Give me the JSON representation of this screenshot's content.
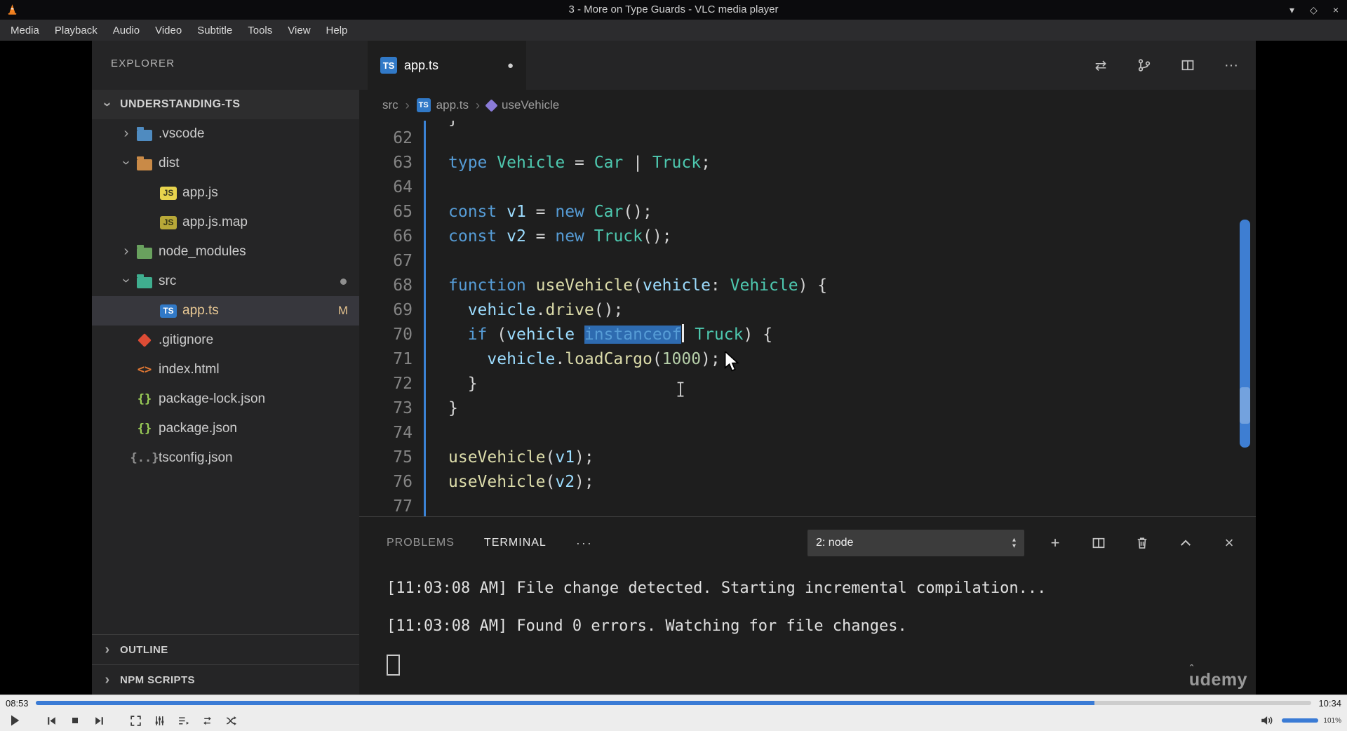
{
  "icons": {
    "chevron": "›",
    "window_min": "▾",
    "window_max": "◇",
    "window_close": "×",
    "tab_dirty_dot": "●",
    "overflow": "···",
    "plus": "+",
    "close": "×",
    "open_changes": "⇄",
    "breadcrumb_sep": "›",
    "dropdown_up": "▴",
    "dropdown_down": "▾"
  },
  "vlc": {
    "titlebar": {
      "title": "3 - More on Type Guards - VLC media player"
    },
    "menu_items": [
      "Media",
      "Playback",
      "Audio",
      "Video",
      "Subtitle",
      "Tools",
      "View",
      "Help"
    ],
    "seek": {
      "elapsed": "08:53",
      "total": "10:34",
      "progress_pct": 83
    },
    "volume": {
      "label": "101%",
      "fill_pct": 100
    }
  },
  "vscode": {
    "explorer": {
      "header": "EXPLORER",
      "project_label": "UNDERSTANDING-TS",
      "tree": [
        {
          "label": ".vscode",
          "depth": 1,
          "chevron": "collapsed",
          "icon": {
            "kind": "folder",
            "color": "#4f8bc0"
          }
        },
        {
          "label": "dist",
          "depth": 1,
          "chevron": "expanded",
          "icon": {
            "kind": "folder",
            "color": "#c98a47"
          }
        },
        {
          "label": "app.js",
          "depth": 2,
          "icon": {
            "kind": "badge",
            "text": "JS",
            "bg": "#e8d44d",
            "fg": "#3a3a20"
          }
        },
        {
          "label": "app.js.map",
          "depth": 2,
          "icon": {
            "kind": "badge",
            "text": "JS",
            "bg": "#b8a838",
            "fg": "#343414"
          }
        },
        {
          "label": "node_modules",
          "depth": 1,
          "chevron": "collapsed",
          "icon": {
            "kind": "folder",
            "color": "#69a15e"
          }
        },
        {
          "label": "src",
          "depth": 1,
          "chevron": "expanded",
          "icon": {
            "kind": "folder",
            "color": "#3fae8f"
          },
          "dot": true
        },
        {
          "label": "app.ts",
          "depth": 2,
          "icon": {
            "kind": "badge",
            "text": "TS",
            "bg": "#3179c7",
            "fg": "#ffffff"
          },
          "selected": true,
          "badge": "M"
        },
        {
          "label": ".gitignore",
          "depth": 1,
          "icon": {
            "kind": "diamond",
            "color": "#dd4c35"
          }
        },
        {
          "label": "index.html",
          "depth": 1,
          "icon": {
            "kind": "glyph",
            "text": "<>",
            "color": "#e37933"
          }
        },
        {
          "label": "package-lock.json",
          "depth": 1,
          "icon": {
            "kind": "glyph",
            "text": "{}",
            "color": "#9acd57"
          }
        },
        {
          "label": "package.json",
          "depth": 1,
          "icon": {
            "kind": "glyph",
            "text": "{}",
            "color": "#9acd57"
          }
        },
        {
          "label": "tsconfig.json",
          "depth": 1,
          "icon": {
            "kind": "glyph",
            "text": "{..}",
            "color": "#8f8f8f"
          }
        }
      ],
      "sections": [
        {
          "label": "OUTLINE"
        },
        {
          "label": "NPM SCRIPTS"
        }
      ]
    },
    "editor": {
      "tab": {
        "label": "app.ts",
        "icon_text": "TS",
        "dirty": true
      },
      "breadcrumbs": [
        {
          "label": "src"
        },
        {
          "label": "app.ts",
          "icon": "ts",
          "icon_text": "TS"
        },
        {
          "label": "useVehicle",
          "icon": "symbol"
        }
      ],
      "clipped_fragment": "}",
      "code_lines": [
        {
          "num": 62,
          "tokens": []
        },
        {
          "num": 63,
          "tokens": [
            {
              "c": "k",
              "t": "type"
            },
            {
              "c": "p",
              "t": " "
            },
            {
              "c": "t",
              "t": "Vehicle"
            },
            {
              "c": "p",
              "t": " = "
            },
            {
              "c": "t",
              "t": "Car"
            },
            {
              "c": "p",
              "t": " | "
            },
            {
              "c": "t",
              "t": "Truck"
            },
            {
              "c": "p",
              "t": ";"
            }
          ]
        },
        {
          "num": 64,
          "tokens": []
        },
        {
          "num": 65,
          "tokens": [
            {
              "c": "k",
              "t": "const"
            },
            {
              "c": "p",
              "t": " "
            },
            {
              "c": "v",
              "t": "v1"
            },
            {
              "c": "p",
              "t": " = "
            },
            {
              "c": "k",
              "t": "new"
            },
            {
              "c": "p",
              "t": " "
            },
            {
              "c": "t",
              "t": "Car"
            },
            {
              "c": "p",
              "t": "();"
            }
          ]
        },
        {
          "num": 66,
          "tokens": [
            {
              "c": "k",
              "t": "const"
            },
            {
              "c": "p",
              "t": " "
            },
            {
              "c": "v",
              "t": "v2"
            },
            {
              "c": "p",
              "t": " = "
            },
            {
              "c": "k",
              "t": "new"
            },
            {
              "c": "p",
              "t": " "
            },
            {
              "c": "t",
              "t": "Truck"
            },
            {
              "c": "p",
              "t": "();"
            }
          ]
        },
        {
          "num": 67,
          "tokens": []
        },
        {
          "num": 68,
          "tokens": [
            {
              "c": "k",
              "t": "function"
            },
            {
              "c": "p",
              "t": " "
            },
            {
              "c": "f",
              "t": "useVehicle"
            },
            {
              "c": "p",
              "t": "("
            },
            {
              "c": "v",
              "t": "vehicle"
            },
            {
              "c": "p",
              "t": ": "
            },
            {
              "c": "t",
              "t": "Vehicle"
            },
            {
              "c": "p",
              "t": ") {"
            }
          ]
        },
        {
          "num": 69,
          "tokens": [
            {
              "c": "p",
              "t": "  "
            },
            {
              "c": "v",
              "t": "vehicle"
            },
            {
              "c": "p",
              "t": "."
            },
            {
              "c": "f",
              "t": "drive"
            },
            {
              "c": "p",
              "t": "();"
            }
          ]
        },
        {
          "num": 70,
          "tokens": [
            {
              "c": "p",
              "t": "  "
            },
            {
              "c": "k",
              "t": "if"
            },
            {
              "c": "p",
              "t": " ("
            },
            {
              "c": "v",
              "t": "vehicle"
            },
            {
              "c": "p",
              "t": " "
            },
            {
              "c": "k",
              "t": "instanceof",
              "sel": true,
              "cursor": true
            },
            {
              "c": "p",
              "t": " "
            },
            {
              "c": "t",
              "t": "Truck"
            },
            {
              "c": "p",
              "t": ") {"
            }
          ]
        },
        {
          "num": 71,
          "tokens": [
            {
              "c": "p",
              "t": "    "
            },
            {
              "c": "v",
              "t": "vehicle"
            },
            {
              "c": "p",
              "t": "."
            },
            {
              "c": "f",
              "t": "loadCargo"
            },
            {
              "c": "p",
              "t": "("
            },
            {
              "c": "n",
              "t": "1000"
            },
            {
              "c": "p",
              "t": ");"
            }
          ]
        },
        {
          "num": 72,
          "tokens": [
            {
              "c": "p",
              "t": "  }"
            }
          ]
        },
        {
          "num": 73,
          "tokens": [
            {
              "c": "p",
              "t": "}"
            }
          ]
        },
        {
          "num": 74,
          "tokens": []
        },
        {
          "num": 75,
          "tokens": [
            {
              "c": "f",
              "t": "useVehicle"
            },
            {
              "c": "p",
              "t": "("
            },
            {
              "c": "v",
              "t": "v1"
            },
            {
              "c": "p",
              "t": ");"
            }
          ]
        },
        {
          "num": 76,
          "tokens": [
            {
              "c": "f",
              "t": "useVehicle"
            },
            {
              "c": "p",
              "t": "("
            },
            {
              "c": "v",
              "t": "v2"
            },
            {
              "c": "p",
              "t": ");"
            }
          ]
        },
        {
          "num": 77,
          "tokens": []
        }
      ]
    },
    "panel": {
      "tabs": [
        {
          "label": "PROBLEMS",
          "active": false
        },
        {
          "label": "TERMINAL",
          "active": true
        }
      ],
      "dropdown_value": "2: node",
      "terminal_lines": [
        "[11:03:08 AM] File change detected. Starting incremental compilation...",
        "[11:03:08 AM] Found 0 errors. Watching for file changes."
      ],
      "watermark": "udemy",
      "watermark_caret": "ˆ"
    }
  }
}
